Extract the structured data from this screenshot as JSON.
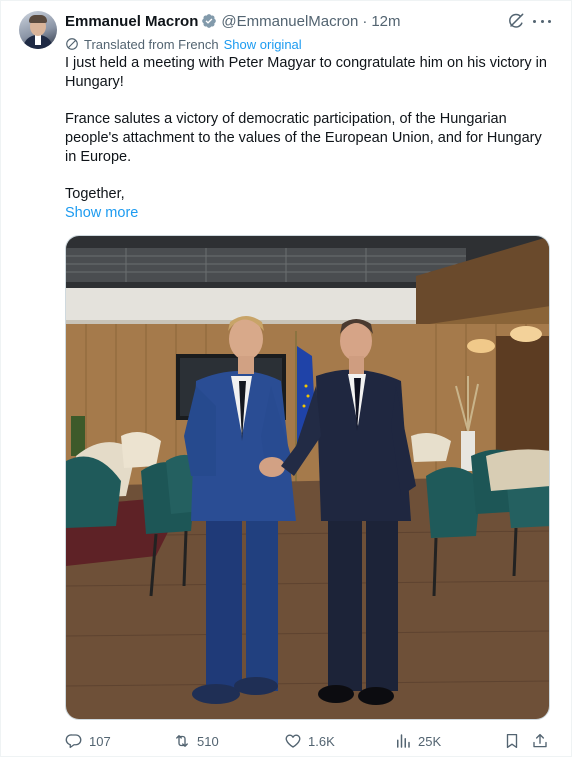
{
  "author": {
    "name": "Emmanuel Macron",
    "handle": "@EmmanuelMacron",
    "separator": "·",
    "time": "12m"
  },
  "translation": {
    "label": "Translated from French",
    "link": "Show original"
  },
  "tweet": {
    "paragraphs": [
      "I just held a meeting with Peter Magyar to congratulate him on his victory in Hungary!",
      "France salutes a victory of democratic participation, of the Hungarian people's attachment to the values of the European Union, and for Hungary in Europe.",
      "Together,"
    ],
    "show_more": "Show more"
  },
  "actions": {
    "replies": "107",
    "reposts": "510",
    "likes": "1.6K",
    "views": "25K"
  },
  "colors": {
    "accent": "#1d9bf0",
    "secondary_text": "#536471",
    "primary_text": "#0f1419"
  },
  "icons": [
    "verified-badge-icon",
    "grok-icon",
    "more-icon",
    "translate-icon",
    "reply-icon",
    "repost-icon",
    "like-icon",
    "views-icon",
    "bookmark-icon",
    "share-icon"
  ]
}
